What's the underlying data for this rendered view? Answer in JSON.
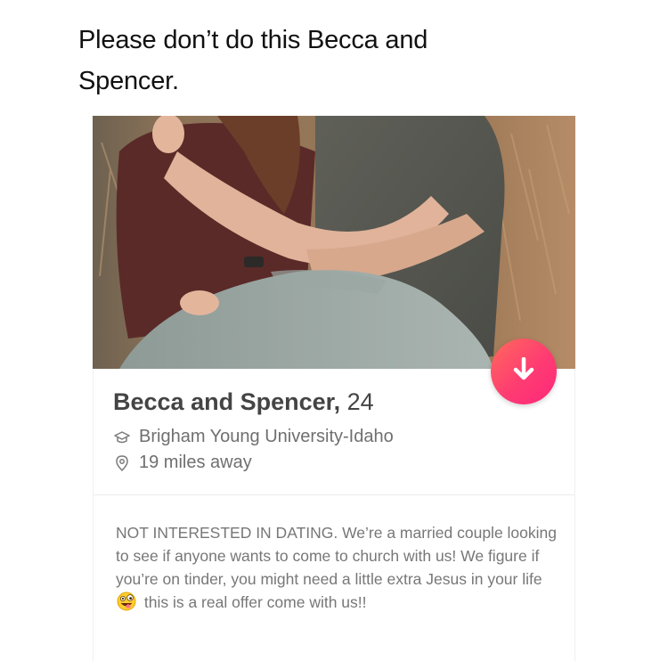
{
  "caption": {
    "line1": "Please don’t do this Becca and",
    "line2": "Spencer."
  },
  "profile": {
    "name": "Becca and Spencer,",
    "age": "24",
    "school": "Brigham Young University-Idaho",
    "distance": "19 miles away",
    "bio_part1": "NOT INTERESTED IN DATING. We’re a married couple looking to see if anyone wants to come to church with us! We figure if you’re on tinder, you might need a little extra Jesus in your life",
    "bio_part2": " this is a real offer come with us!!",
    "photo_alt": "couple embracing photo"
  },
  "icons": {
    "dislike": "arrow-down-icon",
    "school": "graduation-cap-icon",
    "distance": "location-pin-icon",
    "emoji": "zany-face-emoji"
  },
  "colors": {
    "accent_start": "#ff6a5c",
    "accent_end": "#fd267a",
    "name_text": "#444444",
    "meta_text": "#6f6f6f",
    "bio_text": "#777777"
  }
}
